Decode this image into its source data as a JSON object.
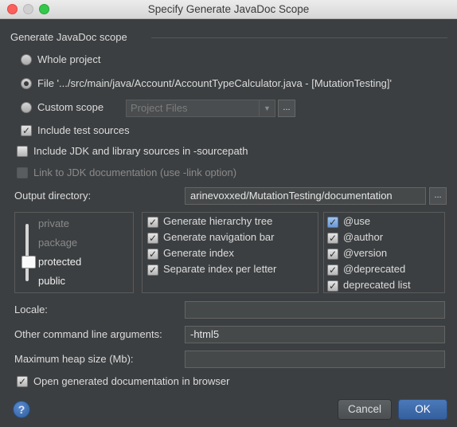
{
  "window": {
    "title": "Specify Generate JavaDoc Scope"
  },
  "scope": {
    "group_label": "Generate JavaDoc scope",
    "whole_project": "Whole project",
    "file": "File '.../src/main/java/Account/AccountTypeCalculator.java - [MutationTesting]'",
    "custom_scope": "Custom scope",
    "custom_scope_value": "Project Files",
    "selected": "file"
  },
  "options": {
    "include_test_sources": "Include test sources",
    "include_jdk": "Include JDK and library sources in -sourcepath",
    "link_jdk": "Link to JDK documentation (use -link option)"
  },
  "output": {
    "label": "Output directory:",
    "value": "arinevoxxed/MutationTesting/documentation"
  },
  "visibility": {
    "levels": [
      "private",
      "package",
      "protected",
      "public"
    ],
    "selected": "protected"
  },
  "generate": {
    "hierarchy": "Generate hierarchy tree",
    "navigation": "Generate navigation bar",
    "index": "Generate index",
    "separate_index": "Separate index per letter"
  },
  "tags": {
    "use": "@use",
    "author": "@author",
    "version": "@version",
    "deprecated": "@deprecated",
    "deprecated_list": "deprecated list"
  },
  "locale": {
    "label": "Locale:",
    "value": ""
  },
  "args": {
    "label": "Other command line arguments:",
    "value": "-html5"
  },
  "heap": {
    "label": "Maximum heap size (Mb):",
    "value": ""
  },
  "open_browser": "Open generated documentation in browser",
  "buttons": {
    "cancel": "Cancel",
    "ok": "OK",
    "help": "?",
    "browse": "...",
    "dots": "..."
  },
  "colors": {
    "background": "#3c3f41",
    "ok_button": "#4a79b9",
    "close": "#fc605c",
    "maximize": "#34c84a"
  }
}
